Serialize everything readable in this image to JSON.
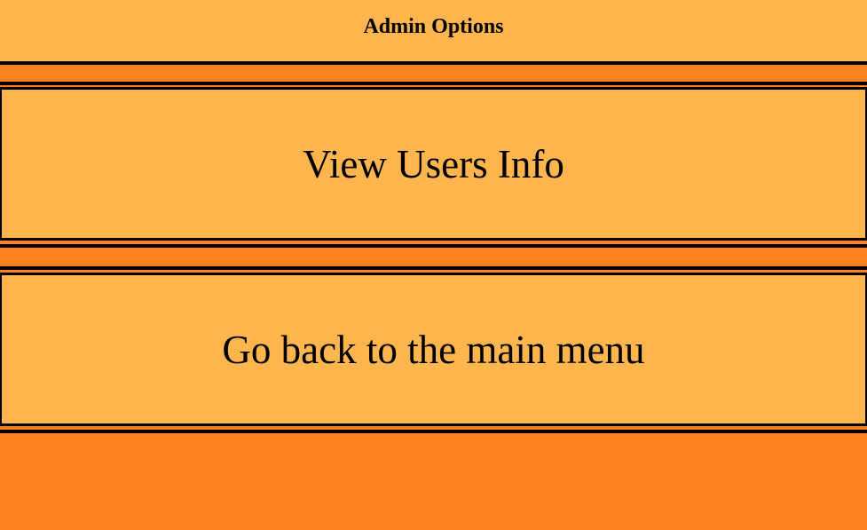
{
  "header": {
    "title": "Admin Options"
  },
  "menu": {
    "options": [
      {
        "label": "View Users Info"
      },
      {
        "label": "Go back to the main menu"
      }
    ]
  },
  "colors": {
    "background": "#FF8222",
    "panel": "#FDB64E",
    "border": "#000000"
  }
}
